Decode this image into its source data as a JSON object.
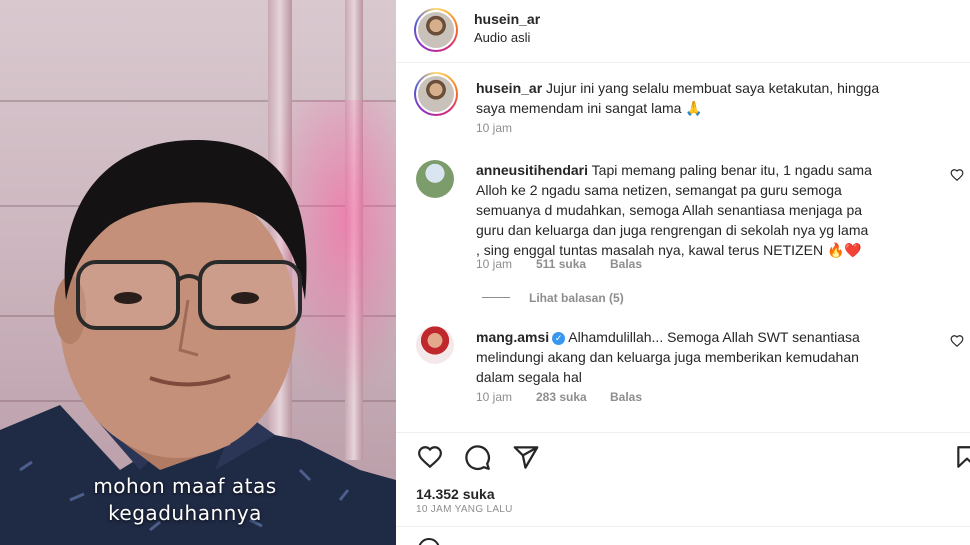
{
  "video": {
    "subtitle_line1": "mohon maaf atas",
    "subtitle_line2": "kegaduhannya"
  },
  "post_header": {
    "username": "husein_ar",
    "subtitle": "Audio asli"
  },
  "caption": {
    "username": "husein_ar",
    "text_line1": "Jujur ini yang selalu membuat saya ketakutan, hingga",
    "text_line2": "saya memendam ini sangat lama 🙏",
    "time": "10 jam"
  },
  "comments": [
    {
      "username": "anneusitihendari",
      "lines": [
        "Tapi memang paling benar itu, 1 ngadu sama",
        "Alloh ke 2 ngadu sama netizen, semangat pa guru semoga",
        "semuanya d mudahkan, semoga Allah senantiasa menjaga pa",
        "guru dan keluarga dan juga rengrengan di sekolah nya yg lama",
        ", sing enggal tuntas masalah nya, kawal terus NETIZEN 🔥❤️"
      ],
      "time": "10 jam",
      "likes": "511 suka",
      "reply": "Balas",
      "view_replies": "Lihat balasan (5)"
    },
    {
      "username": "mang.amsi",
      "verified": "✓",
      "lines": [
        "Alhamdulillah... Semoga Allah SWT senantiasa",
        "melindungi akang dan keluarga juga memberikan kemudahan",
        "dalam segala hal"
      ],
      "time": "10 jam",
      "likes": "283 suka",
      "reply": "Balas"
    }
  ],
  "actions": {
    "like_icon": "heart-icon",
    "comment_icon": "comment-icon",
    "share_icon": "paper-plane-icon",
    "save_icon": "bookmark-icon"
  },
  "stats": {
    "likes": "14.352 suka",
    "time_ago": "10 JAM YANG LALU"
  },
  "colors": {
    "accent_blue": "#3897f0",
    "text": "#262626",
    "muted": "#8e8e8e",
    "heart_red": "#ed4956"
  }
}
